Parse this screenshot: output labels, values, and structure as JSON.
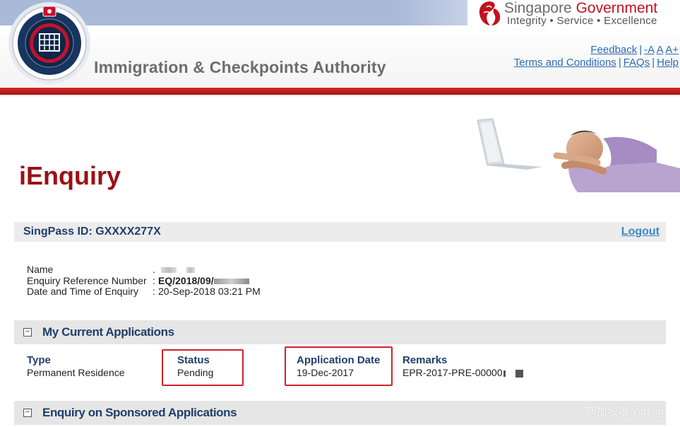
{
  "header": {
    "agency_name": "Immigration & Checkpoints Authority",
    "sg_title_1": "Singapore",
    "sg_title_2": "Government",
    "sg_motto": "Integrity • Service • Excellence",
    "links": {
      "feedback": "Feedback",
      "font_decrease": "-A",
      "font_normal": "A",
      "font_increase": "A+",
      "terms": "Terms and Conditions",
      "faqs": "FAQs",
      "help": "Help"
    },
    "brand_red": "#c1121f",
    "band_color": "#a9b9d8"
  },
  "page": {
    "title": "iEnquiry",
    "title_color": "#9b1016"
  },
  "account": {
    "singpass_label": "SingPass ID: GXXXX277X",
    "logout_label": "Logout"
  },
  "details": {
    "name_label": "Name",
    "name_value": ".",
    "ref_label": "Enquiry Reference Number",
    "ref_value": "EQ/2018/09/",
    "datetime_label": "Date and Time of Enquiry",
    "datetime_value": "20-Sep-2018 03:21 PM",
    "separator": ":"
  },
  "applications": {
    "section_title": "My Current Applications",
    "toggle_symbol": "−",
    "columns": {
      "type": "Type",
      "status": "Status",
      "date": "Application Date",
      "remarks": "Remarks"
    },
    "rows": [
      {
        "type": "Permanent Residence",
        "status": "Pending",
        "date": "19-Dec-2017",
        "remarks": "EPR-2017-PRE-00000"
      }
    ],
    "highlight_color": "#d1212a"
  },
  "sponsored": {
    "section_title": "Enquiry on Sponsored Applications",
    "toggle_symbol": "−"
  },
  "watermark": "新加坡眼 Yan.sg",
  "icons": {
    "crest": "ica-crest-icon",
    "lion": "merlion-lion-head-icon",
    "hero": "man-with-laptop-illustration"
  }
}
